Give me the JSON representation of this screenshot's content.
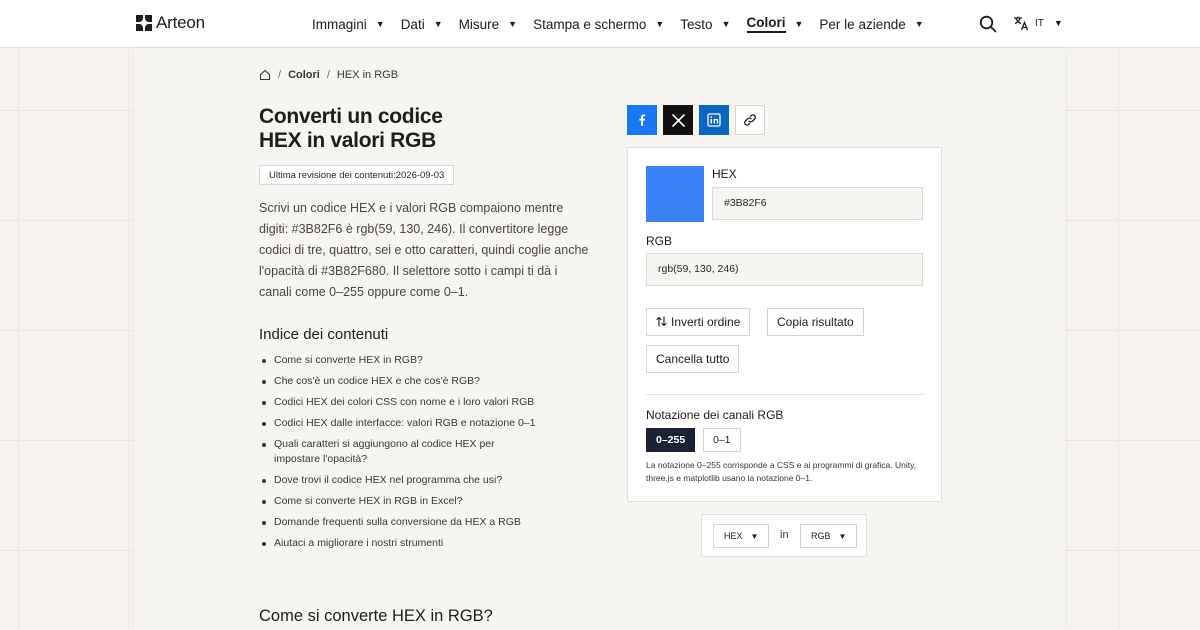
{
  "header": {
    "logo_text": "Arteon",
    "nav": [
      {
        "label": "Immagini",
        "active": false
      },
      {
        "label": "Dati",
        "active": false
      },
      {
        "label": "Misure",
        "active": false
      },
      {
        "label": "Stampa e schermo",
        "active": false
      },
      {
        "label": "Testo",
        "active": false
      },
      {
        "label": "Colori",
        "active": true
      },
      {
        "label": "Per le aziende",
        "active": false
      }
    ],
    "caret": "▼",
    "lang_code": "IT"
  },
  "breadcrumb": {
    "section": "Colori",
    "current": "HEX in RGB",
    "separator": "/"
  },
  "page": {
    "title_line1": "Converti un codice",
    "title_line2": "HEX in valori RGB",
    "revision": "Ultima revisione dei contenuti:2026-09-03",
    "intro": "Scrivi un codice HEX e i valori RGB compaiono mentre digiti: #3B82F6 è rgb(59, 130, 246). Il convertitore legge codici di tre, quattro, sei e otto caratteri, quindi coglie anche l'opacità di #3B82F680. Il selettore sotto i campi ti dà i canali come 0–255 oppure come 0–1.",
    "toc_title": "Indice dei contenuti",
    "toc": [
      "Come si converte HEX in RGB?",
      "Che cos'è un codice HEX e che cos'è RGB?",
      "Codici HEX dei colori CSS con nome e i loro valori RGB",
      "Codici HEX dalle interfacce: valori RGB e notazione 0–1",
      "Quali caratteri si aggiungono al codice HEX per impostare l'opacità?",
      "Dove trovi il codice HEX nel programma che usi?",
      "Come si converte HEX in RGB in Excel?",
      "Domande frequenti sulla conversione da HEX a RGB",
      "Aiutaci a migliorare i nostri strumenti"
    ],
    "section_title": "Come si converte HEX in RGB?"
  },
  "converter": {
    "swatch_color": "#3B82F6",
    "hex_label": "HEX",
    "hex_value": "#3B82F6",
    "rgb_label": "RGB",
    "rgb_value": "rgb(59, 130, 246)",
    "swap_label": "Inverti ordine",
    "copy_label": "Copia risultato",
    "clear_label": "Cancella tutto",
    "notation_label": "Notazione dei canali RGB",
    "notation_options": [
      "0–255",
      "0–1"
    ],
    "notation_selected": "0–255",
    "notation_note": "La notazione 0–255 corrisponde a CSS e ai programmi di grafica. Unity, three.js e matplotlib usano la notazione 0–1."
  },
  "direction": {
    "from": "HEX",
    "connector": "in",
    "to": "RGB"
  },
  "colors": {
    "accent_dark": "#1B2233",
    "facebook": "#1877F2",
    "x": "#111111",
    "linkedin": "#0A66C2"
  }
}
